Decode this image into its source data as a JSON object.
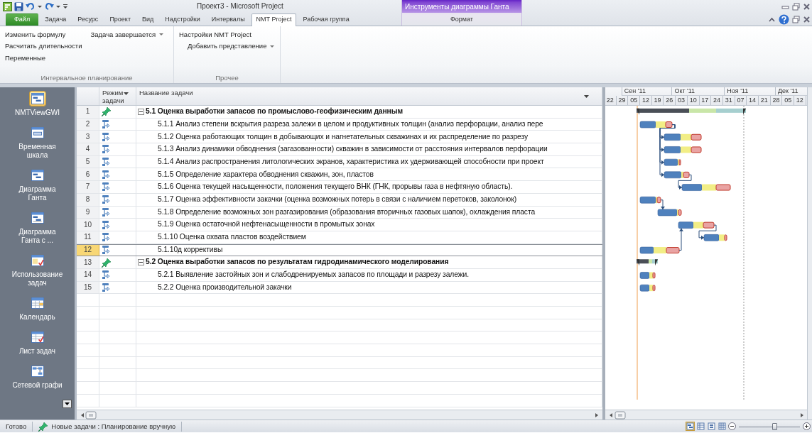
{
  "window": {
    "title": "Проект3 - Microsoft Project"
  },
  "contextual_group": "Инструменты диаграммы Ганта",
  "tabs": [
    {
      "label": "Файл",
      "kind": "file",
      "selected": false
    },
    {
      "label": "Задача",
      "kind": "normal",
      "selected": false
    },
    {
      "label": "Ресурс",
      "kind": "normal",
      "selected": false
    },
    {
      "label": "Проект",
      "kind": "normal",
      "selected": false
    },
    {
      "label": "Вид",
      "kind": "normal",
      "selected": false
    },
    {
      "label": "Надстройки",
      "kind": "normal",
      "selected": false
    },
    {
      "label": "Интервалы",
      "kind": "normal",
      "selected": false
    },
    {
      "label": "NMT Project",
      "kind": "normal",
      "selected": true
    },
    {
      "label": "Рабочая группа",
      "kind": "normal",
      "selected": false
    },
    {
      "label": "Формат",
      "kind": "contextual",
      "selected": false
    }
  ],
  "ribbon_groups": [
    {
      "label": "Интервальное планирование",
      "columns": [
        [
          {
            "label": "Изменить формулу",
            "dropdown": false
          },
          {
            "label": "Расчитать длительности",
            "dropdown": false
          },
          {
            "label": "Переменные",
            "dropdown": false
          }
        ],
        [
          {
            "label": "Задача завершается",
            "dropdown": true
          }
        ]
      ]
    },
    {
      "label": "Прочее",
      "columns": [
        [
          {
            "label": "Настройки NMT Project",
            "dropdown": false
          },
          {
            "label": "Добавить представление",
            "dropdown": true
          }
        ]
      ]
    }
  ],
  "views": [
    {
      "label": "NMTViewGWI",
      "selected": true
    },
    {
      "label": "Временная шкала",
      "selected": false
    },
    {
      "label": "Диаграмма Ганта",
      "selected": false
    },
    {
      "label": "Диаграмма Ганта с ...",
      "selected": false
    },
    {
      "label": "Использование задач",
      "selected": false
    },
    {
      "label": "Календарь",
      "selected": false
    },
    {
      "label": "Лист задач",
      "selected": false
    },
    {
      "label": "Сетевой графи",
      "selected": false
    }
  ],
  "table": {
    "columns": [
      "Режим задачи",
      "Название задачи"
    ],
    "rows": [
      {
        "id": "1",
        "kind": "manual",
        "name": "5.1 Оценка выработки запасов по промыслово-геофизическим данным",
        "expanded": true,
        "selected": false,
        "children": [
          {
            "id": "2",
            "kind": "auto",
            "name": "5.1.1 Анализ степени вскрытия разреза залежи в целом и продуктивных толщин (анализ перфорации, анализ пере",
            "selected": false
          },
          {
            "id": "3",
            "kind": "auto",
            "name": "5.1.2 Оценка работающих толщин в добывающих и нагнетательных скважинах и их распределение по разрезу",
            "selected": false
          },
          {
            "id": "4",
            "kind": "auto",
            "name": "5.1.3 Анализ динамики обводнения (загазованности) скважин в зависимости от расстояния интервалов перфорации",
            "selected": false
          },
          {
            "id": "5",
            "kind": "auto",
            "name": "5.1.4 Анализ распространения литологических экранов, характеристика их удерживающей способности при проект",
            "selected": false
          },
          {
            "id": "6",
            "kind": "auto",
            "name": "5.1.5 Определение характера обводнения скважин, зон, пластов",
            "selected": false
          },
          {
            "id": "7",
            "kind": "auto",
            "name": "5.1.6 Оценка текущей насыщенности, положения текущего ВНК (ГНК, прорывы газа в нефтяную область).",
            "selected": false
          },
          {
            "id": "8",
            "kind": "auto",
            "name": "5.1.7 Оценка эффективности закачки (оценка возможных потерь в связи с наличием перетоков, заколонок)",
            "selected": false
          },
          {
            "id": "9",
            "kind": "auto",
            "name": "5.1.8 Определение возможных зон разгазирования (образования вторичных газовых шапок), охлаждения пласта",
            "selected": false
          },
          {
            "id": "10",
            "kind": "auto",
            "name": "5.1.9 Оценка остаточной нефтенасыщенности в промытых зонах",
            "selected": false
          },
          {
            "id": "11",
            "kind": "auto",
            "name": "5.1.10 Оценка охвата пластов воздействием",
            "selected": false
          },
          {
            "id": "12",
            "kind": "auto",
            "name": "5.1.10д коррективы",
            "selected": true
          }
        ]
      },
      {
        "id": "13",
        "kind": "manual",
        "name": "5.2 Оценка выработки запасов по результатам гидродинамического моделирования",
        "expanded": true,
        "selected": false,
        "children": [
          {
            "id": "14",
            "kind": "auto",
            "name": "5.2.1 Выявление застойных зон и слабодренируемых запасов по площади и разрезу залежи.",
            "selected": false
          },
          {
            "id": "15",
            "kind": "auto",
            "name": "5.2.2 Оценка производительной закачки",
            "selected": false
          }
        ]
      }
    ]
  },
  "timescale": {
    "months": [
      "Сен '11",
      "Окт '11",
      "Ноя '11",
      "Дек '11"
    ],
    "days": [
      "22",
      "29",
      "05",
      "12",
      "19",
      "26",
      "03",
      "10",
      "17",
      "24",
      "31",
      "07",
      "14",
      "21",
      "28",
      "05",
      "12"
    ]
  },
  "status_bar": {
    "ready": "Готово",
    "new_tasks": "Новые задачи : Планирование вручную",
    "view_buttons": [
      {
        "selected": true
      },
      {
        "selected": false
      },
      {
        "selected": false
      },
      {
        "selected": false
      }
    ],
    "zoom": {
      "level": 0.6
    }
  }
}
